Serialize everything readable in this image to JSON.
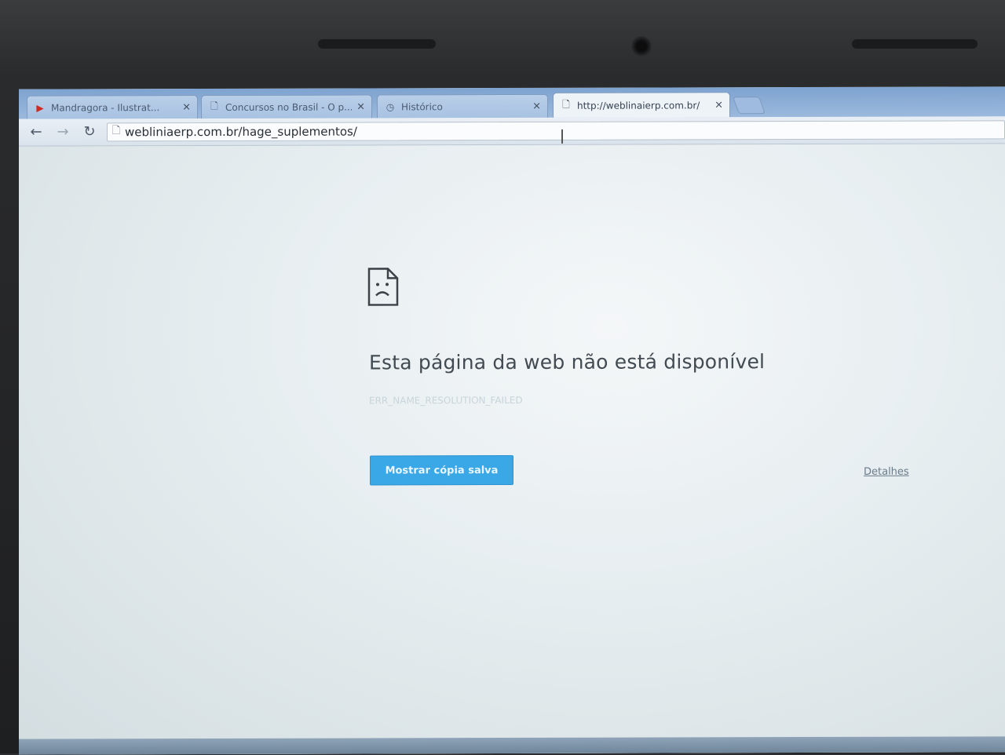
{
  "browser": {
    "tabs": [
      {
        "title": "Mandragora - Ilustrat...",
        "icon": "youtube-icon",
        "active": false
      },
      {
        "title": "Concursos no Brasil - O p...",
        "icon": "page-icon",
        "active": false
      },
      {
        "title": "Histórico",
        "icon": "history-icon",
        "active": false
      },
      {
        "title": "http://weblinaierp.com.br/",
        "icon": "page-icon",
        "active": true
      }
    ],
    "close_glyph": "×",
    "address_bar": {
      "url": "webliniaerp.com.br/hage_suplementos/"
    }
  },
  "error_page": {
    "title": "Esta página da web não está disponível",
    "code": "ERR_NAME_RESOLUTION_FAILED",
    "button_label": "Mostrar cópia salva",
    "details_label": "Detalhes"
  },
  "colors": {
    "button_bg": "#3aa7e6",
    "title_text": "#424a52",
    "tabstrip": "#7ea3d0"
  }
}
